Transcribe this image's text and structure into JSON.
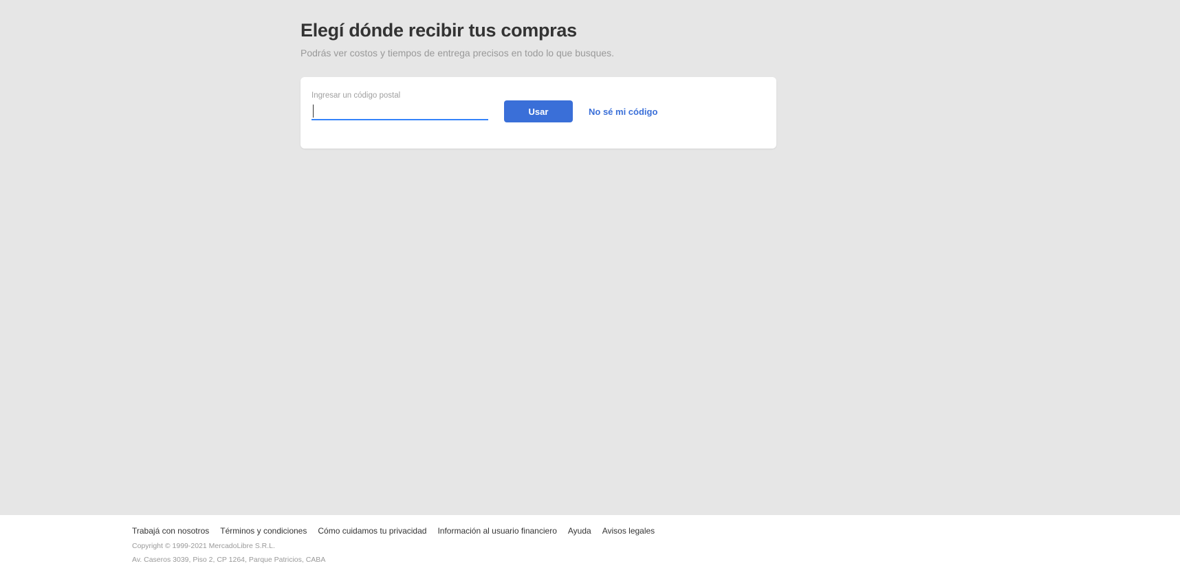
{
  "header": {
    "title": "Elegí dónde recibir tus compras",
    "subtitle": "Podrás ver costos y tiempos de entrega precisos en todo lo que busques."
  },
  "postal_form": {
    "label": "Ingresar un código postal",
    "value": "",
    "placeholder": "",
    "submit_label": "Usar",
    "unknown_link": "No sé mi código"
  },
  "footer": {
    "links": [
      "Trabajá con nosotros",
      "Términos y condiciones",
      "Cómo cuidamos tu privacidad",
      "Información al usuario financiero",
      "Ayuda",
      "Avisos legales"
    ],
    "copyright": "Copyright © 1999-2021 MercadoLibre S.R.L.",
    "address": "Av. Caseros 3039, Piso 2, CP 1264, Parque Patricios, CABA"
  },
  "colors": {
    "background": "#e6e6e6",
    "accent": "#3a6fd8",
    "input_underline": "#3483fa",
    "card": "#ffffff"
  }
}
